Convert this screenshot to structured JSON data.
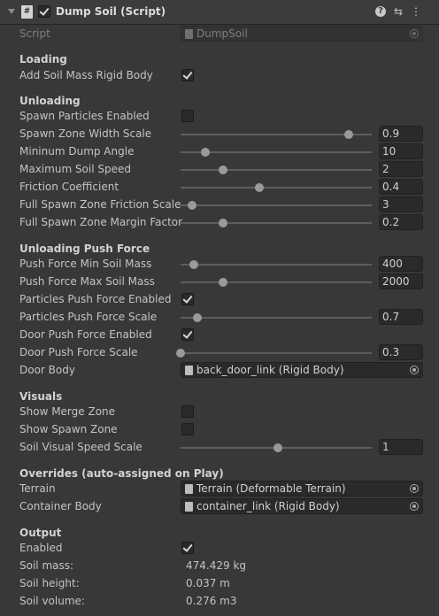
{
  "header": {
    "title": "Dump Soil (Script)",
    "script_icon": "#",
    "help_icon": "?",
    "presets_icon": "⇆",
    "menu_icon": "⋮"
  },
  "script_row": {
    "label": "Script",
    "value": "DumpSoil"
  },
  "loading": {
    "title": "Loading",
    "add_rigid_body": {
      "label": "Add Soil Mass Rigid Body",
      "checked": true
    }
  },
  "unloading": {
    "title": "Unloading",
    "spawn_particles": {
      "label": "Spawn Particles Enabled",
      "checked": false
    },
    "sliders": [
      {
        "label": "Spawn Zone Width Scale",
        "value": "0.9",
        "fraction": 0.88
      },
      {
        "label": "Mininum Dump Angle",
        "value": "10",
        "fraction": 0.13
      },
      {
        "label": "Maximum Soil Speed",
        "value": "2",
        "fraction": 0.22
      },
      {
        "label": "Friction Coefficient",
        "value": "0.4",
        "fraction": 0.41
      },
      {
        "label": "Full Spawn Zone Friction Scale",
        "value": "3",
        "fraction": 0.06
      },
      {
        "label": "Full Spawn Zone Margin Factor",
        "value": "0.2",
        "fraction": 0.22
      }
    ]
  },
  "push": {
    "title": "Unloading Push Force",
    "min_mass": {
      "label": "Push Force Min Soil Mass",
      "value": "400",
      "fraction": 0.07
    },
    "max_mass": {
      "label": "Push Force Max Soil Mass",
      "value": "2000",
      "fraction": 0.22
    },
    "particles_enabled": {
      "label": "Particles Push Force Enabled",
      "checked": true
    },
    "particles_scale": {
      "label": "Particles Push Force Scale",
      "value": "0.7",
      "fraction": 0.09
    },
    "door_enabled": {
      "label": "Door Push Force Enabled",
      "checked": true
    },
    "door_scale": {
      "label": "Door Push Force Scale",
      "value": "0.3",
      "fraction": 0.0
    },
    "door_body": {
      "label": "Door Body",
      "value": "back_door_link (Rigid Body)"
    }
  },
  "visuals": {
    "title": "Visuals",
    "merge_zone": {
      "label": "Show Merge Zone",
      "checked": false
    },
    "spawn_zone": {
      "label": "Show Spawn Zone",
      "checked": false
    },
    "speed_scale": {
      "label": "Soil Visual Speed Scale",
      "value": "1",
      "fraction": 0.51
    }
  },
  "overrides": {
    "title": "Overrides (auto-assigned on Play)",
    "terrain": {
      "label": "Terrain",
      "value": "Terrain (Deformable Terrain)"
    },
    "container": {
      "label": "Container Body",
      "value": "container_link (Rigid Body)"
    }
  },
  "output": {
    "title": "Output",
    "enabled": {
      "label": "Enabled",
      "checked": true
    },
    "mass": {
      "label": "Soil mass:",
      "value": "474.429 kg"
    },
    "height": {
      "label": "Soil height:",
      "value": "0.037 m"
    },
    "volume": {
      "label": "Soil volume:",
      "value": "0.276 m3"
    }
  }
}
